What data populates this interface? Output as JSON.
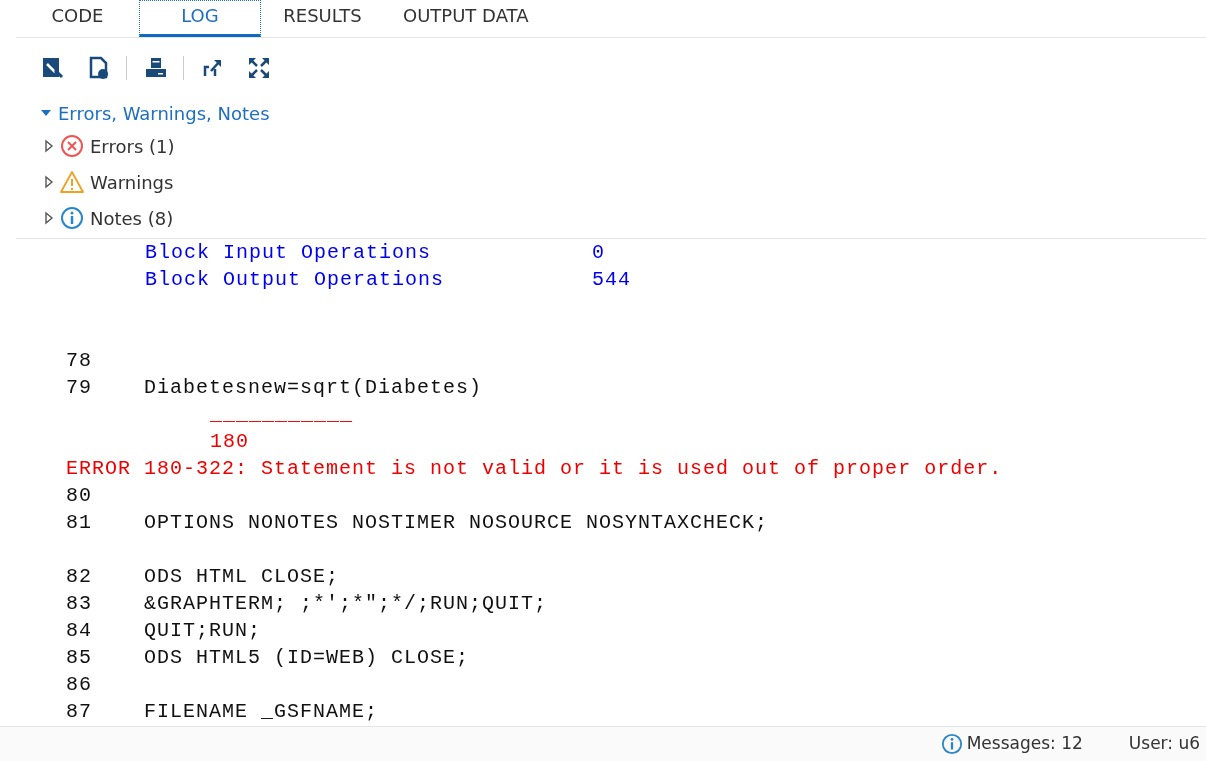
{
  "tabs": [
    {
      "label": "CODE",
      "selected": false
    },
    {
      "label": "LOG",
      "selected": true
    },
    {
      "label": "RESULTS",
      "selected": false
    },
    {
      "label": "OUTPUT DATA",
      "selected": false
    }
  ],
  "tree": {
    "label": "Errors, Warnings, Notes",
    "expanded": true,
    "children": [
      {
        "label": "Errors (1)",
        "kind": "error",
        "expanded": false
      },
      {
        "label": "Warnings",
        "kind": "warning",
        "expanded": false
      },
      {
        "label": "Notes (8)",
        "kind": "note",
        "expanded": false
      }
    ]
  },
  "log": {
    "lines": [
      {
        "kind": "note",
        "text": "Block Input Operations",
        "value": "0"
      },
      {
        "kind": "note",
        "text": "Block Output Operations",
        "value": "544"
      },
      {
        "kind": "blank"
      },
      {
        "kind": "blank"
      },
      {
        "kind": "source",
        "number": "78"
      },
      {
        "kind": "source",
        "number": "79",
        "text": "Diabetesnew=sqrt(Diabetes)"
      },
      {
        "kind": "marker",
        "text": "___________"
      },
      {
        "kind": "marker",
        "text": "180"
      },
      {
        "kind": "error",
        "text": "ERROR 180-322: Statement is not valid or it is used out of proper order."
      },
      {
        "kind": "source",
        "number": "80"
      },
      {
        "kind": "source",
        "number": "81",
        "text": "OPTIONS NONOTES NOSTIMER NOSOURCE NOSYNTAXCHECK;"
      },
      {
        "kind": "blank"
      },
      {
        "kind": "source",
        "number": "82",
        "text": "ODS HTML CLOSE;"
      },
      {
        "kind": "source",
        "number": "83",
        "text": "&GRAPHTERM; ;*';*\";*/;RUN;QUIT;"
      },
      {
        "kind": "source",
        "number": "84",
        "text": "QUIT;RUN;"
      },
      {
        "kind": "source",
        "number": "85",
        "text": "ODS HTML5 (ID=WEB) CLOSE;"
      },
      {
        "kind": "source",
        "number": "86"
      },
      {
        "kind": "source",
        "number": "87",
        "text": "FILENAME _GSFNAME;"
      }
    ]
  },
  "status_bar": {
    "messages": "Messages: 12",
    "user": "User: u6"
  }
}
